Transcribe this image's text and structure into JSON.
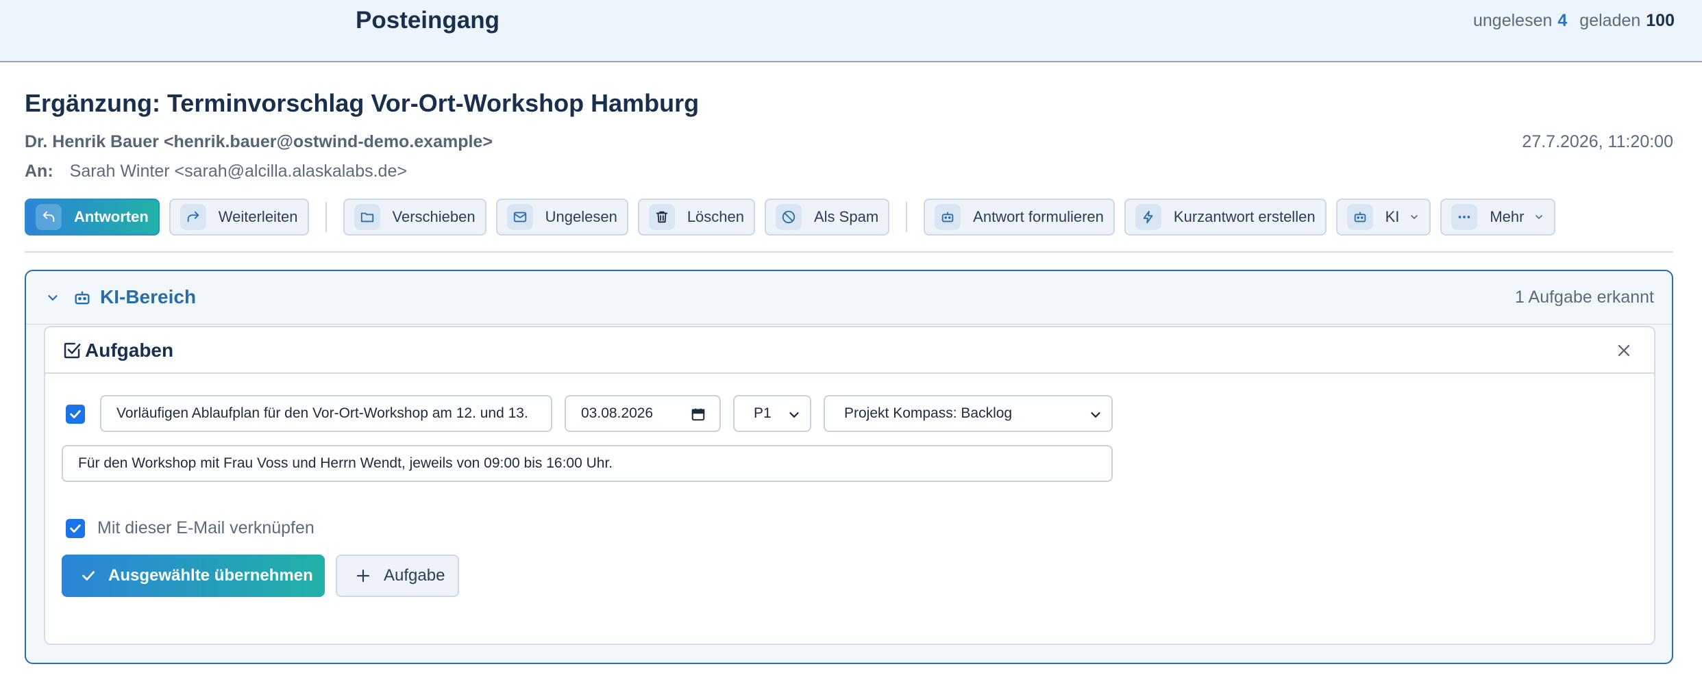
{
  "topbar": {
    "title": "Posteingang",
    "unread_label": "ungelesen",
    "unread_count": "4",
    "loaded_label": "geladen",
    "loaded_count": "100"
  },
  "email": {
    "subject": "Ergänzung: Terminvorschlag Vor-Ort-Workshop Hamburg",
    "from": "Dr. Henrik Bauer <henrik.bauer@ostwind-demo.example>",
    "date": "27.7.2026, 11:20:00",
    "to_label": "An:",
    "to": "Sarah Winter <sarah@alcilla.alaskalabs.de>"
  },
  "toolbar": {
    "reply": "Antworten",
    "forward": "Weiterleiten",
    "move": "Verschieben",
    "unread": "Ungelesen",
    "delete": "Löschen",
    "spam": "Als Spam",
    "compose_reply": "Antwort formulieren",
    "quick_reply": "Kurzantwort erstellen",
    "ai": "KI",
    "more": "Mehr"
  },
  "ai_panel": {
    "title": "KI-Bereich",
    "status": "1 Aufgabe erkannt",
    "tasks_title": "Aufgaben",
    "task": {
      "checked": true,
      "title": "Vorläufigen Ablaufplan für den Vor-Ort-Workshop am 12. und 13.",
      "date": "03.08.2026",
      "priority": "P1",
      "project": "Projekt Kompass: Backlog",
      "description": "Für den Workshop mit Frau Voss und Herrn Wendt, jeweils von 09:00 bis 16:00 Uhr."
    },
    "link_label": "Mit dieser E-Mail verknüpfen",
    "link_checked": true,
    "apply_button": "Ausgewählte übernehmen",
    "add_button": "Aufgabe"
  },
  "colors": {
    "accent": "#2a6ca8",
    "gradient_start": "#2b84d8",
    "gradient_end": "#21b1a6",
    "checkbox": "#1a73e8"
  }
}
